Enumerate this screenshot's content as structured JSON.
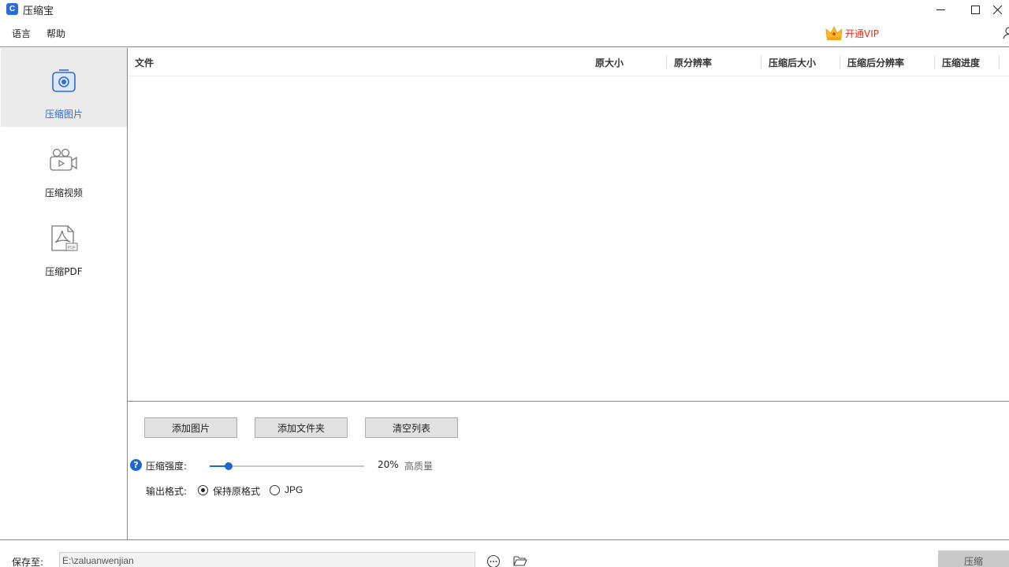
{
  "app": {
    "title": "压缩宝",
    "icon_glyph": "C"
  },
  "menu": {
    "language": "语言",
    "help": "帮助",
    "vip_label": "开通VIP"
  },
  "sidebar": {
    "items": [
      {
        "label": "压缩图片",
        "icon": "image-compress-icon",
        "active": true
      },
      {
        "label": "压缩视频",
        "icon": "video-compress-icon",
        "active": false
      },
      {
        "label": "压缩PDF",
        "icon": "pdf-compress-icon",
        "active": false
      }
    ]
  },
  "table": {
    "columns": [
      "文件",
      "原大小",
      "原分辨率",
      "压缩后大小",
      "压缩后分辨率",
      "压缩进度"
    ],
    "rows": []
  },
  "actions": {
    "add_images": "添加图片",
    "add_folder": "添加文件夹",
    "clear_list": "清空列表"
  },
  "strength": {
    "help_glyph": "?",
    "label": "压缩强度:",
    "value_percent": 20,
    "value_text": "20%",
    "quality_text": "高质量"
  },
  "format": {
    "label": "输出格式:",
    "options": [
      {
        "label": "保持原格式",
        "checked": true
      },
      {
        "label": "JPG",
        "checked": false
      }
    ]
  },
  "footer": {
    "save_to_label": "保存至:",
    "save_path": "E:\\zaluanwenjian",
    "compress_button": "压缩"
  },
  "colors": {
    "accent": "#1f66d3",
    "vip_red": "#e0321b",
    "active_bg": "#ebebeb"
  }
}
